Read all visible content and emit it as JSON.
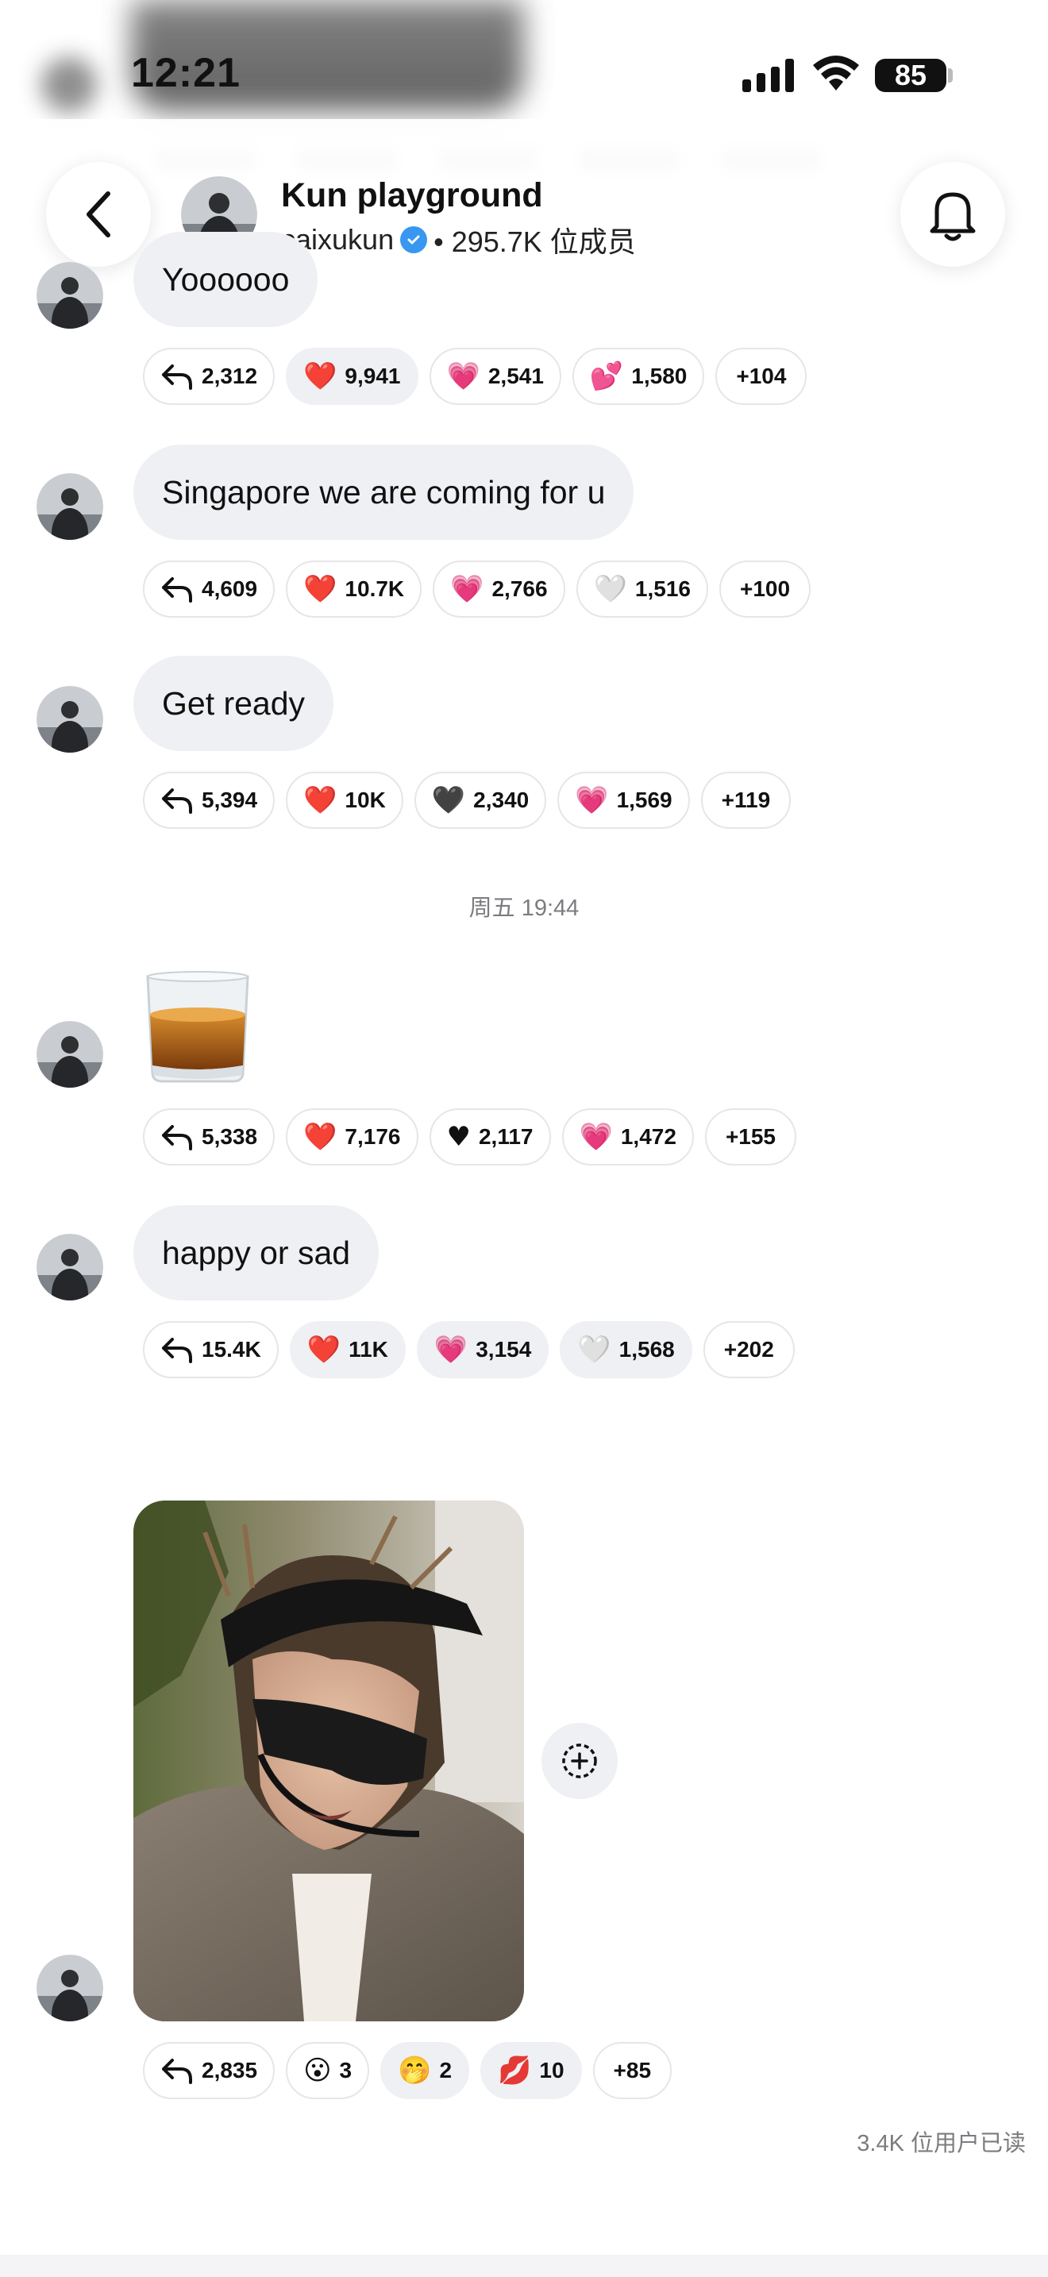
{
  "status_bar": {
    "time": "12:21",
    "battery": "85"
  },
  "header": {
    "title": "Kun playground",
    "username": "caixukun",
    "members": "• 295.7K 位成员",
    "back_icon": "chevron-left-icon",
    "bell_icon": "bell-icon"
  },
  "messages": [
    {
      "text": "Yoooooo",
      "reactions": [
        {
          "emoji": "",
          "count": "2,312"
        },
        {
          "emoji": "❤️",
          "count": "9,941"
        },
        {
          "emoji": "💗",
          "count": "2,541"
        },
        {
          "emoji": "💕",
          "count": "1,580"
        },
        {
          "emoji": "",
          "count": "+104"
        }
      ]
    },
    {
      "text": "Singapore we are coming for u",
      "reactions": [
        {
          "emoji": "",
          "count": "4,609"
        },
        {
          "emoji": "❤️",
          "count": "10.7K"
        },
        {
          "emoji": "💗",
          "count": "2,766"
        },
        {
          "emoji": "🤍",
          "count": "1,516"
        },
        {
          "emoji": "",
          "count": "+100"
        }
      ]
    },
    {
      "text": "Get ready",
      "reactions": [
        {
          "emoji": "",
          "count": "5,394"
        },
        {
          "emoji": "❤️",
          "count": "10K"
        },
        {
          "emoji": "🖤",
          "count": "2,340"
        },
        {
          "emoji": "💗",
          "count": "1,569"
        },
        {
          "emoji": "",
          "count": "+119"
        }
      ]
    },
    {
      "text": "",
      "reactions": [
        {
          "emoji": "",
          "count": "5,338"
        },
        {
          "emoji": "❤️",
          "count": "7,176"
        },
        {
          "emoji": "♥",
          "count": "2,117"
        },
        {
          "emoji": "💗",
          "count": "1,472"
        },
        {
          "emoji": "",
          "count": "+155"
        }
      ]
    },
    {
      "text": "happy or sad",
      "reactions": [
        {
          "emoji": "",
          "count": "15.4K"
        },
        {
          "emoji": "❤️",
          "count": "11K"
        },
        {
          "emoji": "💗",
          "count": "3,154"
        },
        {
          "emoji": "🤍",
          "count": "1,568"
        },
        {
          "emoji": "",
          "count": "+202"
        }
      ]
    },
    {
      "text": "",
      "reactions": [
        {
          "emoji": "",
          "count": "2,835"
        },
        {
          "emoji": "😮",
          "count": "3"
        },
        {
          "emoji": "🤭",
          "count": "2"
        },
        {
          "emoji": "💋",
          "count": "10"
        },
        {
          "emoji": "",
          "count": "+85"
        }
      ]
    }
  ],
  "timestamp": "周五 19:44",
  "read_receipt": "3.4K 位用户已读",
  "colors": {
    "bubble": "#eff0f3",
    "verified": "#3897f0",
    "secondary_text": "#7c7c80"
  }
}
